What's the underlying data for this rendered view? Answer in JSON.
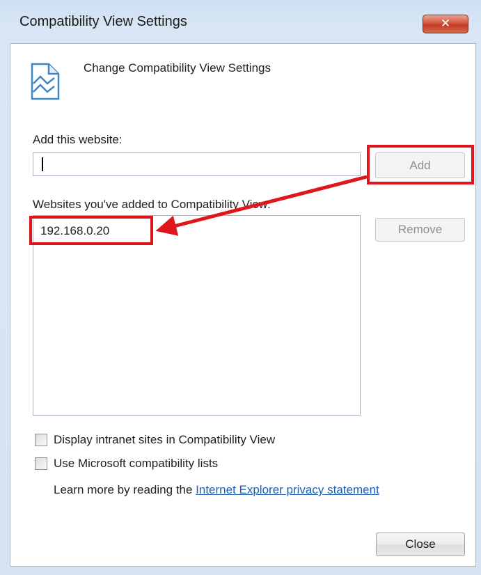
{
  "window": {
    "title": "Compatibility View Settings",
    "close_icon_glyph": "✕"
  },
  "header": {
    "icon": "compatibility-page-icon",
    "text": "Change Compatibility View Settings"
  },
  "add_section": {
    "label": "Add this website:",
    "input_value": "",
    "add_button": "Add"
  },
  "list_section": {
    "label": "Websites you've added to Compatibility View:",
    "items": [
      "192.168.0.20"
    ],
    "remove_button": "Remove"
  },
  "options": [
    {
      "label": "Display intranet sites in Compatibility View",
      "checked": false
    },
    {
      "label": "Use Microsoft compatibility lists",
      "checked": false
    }
  ],
  "learn_more": {
    "prefix": "Learn more by reading the",
    "link": "Internet Explorer privacy statement"
  },
  "footer": {
    "close_button": "Close"
  },
  "annotation_color": "#e0161d"
}
